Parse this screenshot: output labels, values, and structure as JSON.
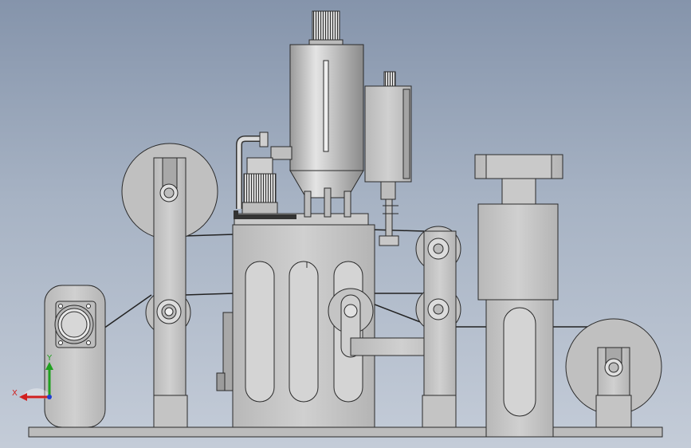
{
  "view": {
    "background_top": "#8594ab",
    "background_bottom": "#c4ccd8",
    "part_fill": "#c6c6c6",
    "part_stroke": "#2a2a2a"
  },
  "triad": {
    "x_label": "X",
    "y_label": "Y",
    "x_color": "#d02020",
    "y_color": "#20a020",
    "z_color": "#2040d0"
  }
}
